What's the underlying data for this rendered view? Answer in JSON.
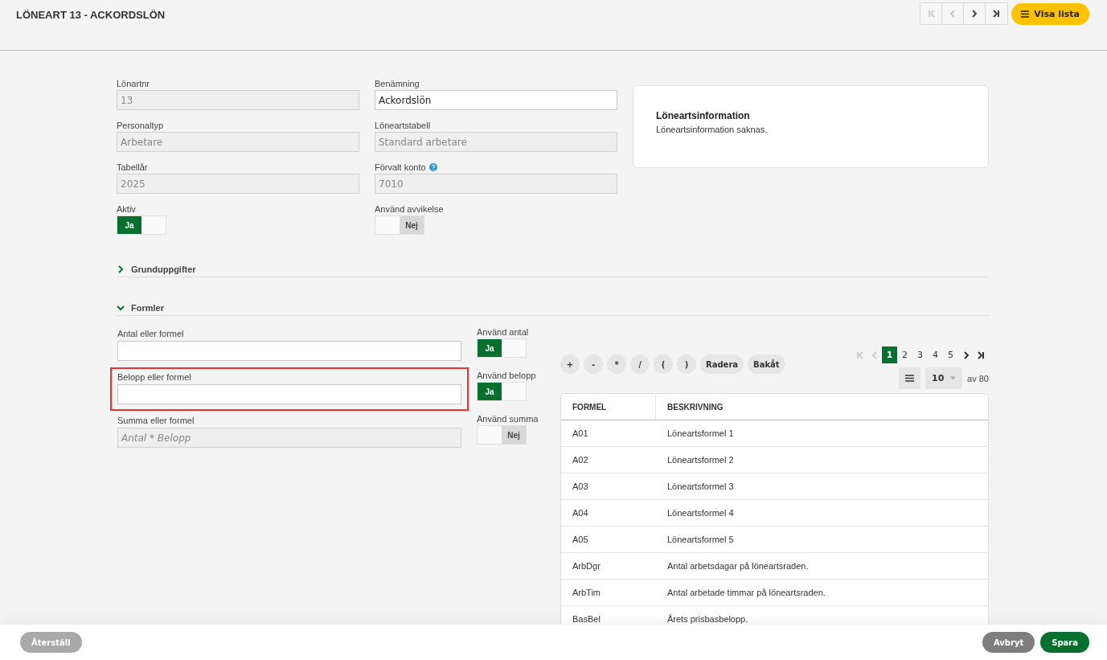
{
  "header": {
    "title": "LÖNEART 13 - ACKORDSLÖN",
    "nav": [
      {
        "kind": "first",
        "disabled": true
      },
      {
        "kind": "prev",
        "disabled": true
      },
      {
        "kind": "next",
        "disabled": false
      },
      {
        "kind": "last",
        "disabled": false
      }
    ],
    "list_button": "Visa lista"
  },
  "fields": [
    {
      "label": "Lönartnr",
      "value": "13",
      "disabled": true,
      "help": false
    },
    {
      "label": "Benämning",
      "value": "Ackordslön",
      "disabled": false,
      "help": false
    },
    {
      "label": "Personaltyp",
      "value": "Arbetare",
      "disabled": true,
      "help": false
    },
    {
      "label": "Löneartstabell",
      "value": "Standard arbetare",
      "disabled": true,
      "help": false
    },
    {
      "label": "Tabellår",
      "value": "2025",
      "disabled": true,
      "help": false
    },
    {
      "label": "Förvalt konto",
      "value": "7010",
      "disabled": true,
      "help": true
    }
  ],
  "toggles": [
    {
      "label": "Aktiv",
      "on": true,
      "text": "Ja"
    },
    {
      "label": "Använd avvikelse",
      "on": false,
      "text": "Nej"
    }
  ],
  "info_card": {
    "title": "Löneartsinformation",
    "text": "Löneartsinformation saknas."
  },
  "sections": [
    {
      "title": "Grunduppgifter",
      "expanded": false
    },
    {
      "title": "Formler",
      "expanded": true
    }
  ],
  "formulas": [
    {
      "label": "Antal eller formel",
      "disabled": false,
      "highlighted": false,
      "toggle": {
        "label": "Använd antal",
        "on": true,
        "text": "Ja"
      }
    },
    {
      "label": "Belopp eller formel",
      "disabled": false,
      "highlighted": true,
      "toggle": {
        "label": "Använd belopp",
        "on": true,
        "text": "Ja"
      }
    },
    {
      "label": "Summa eller formel",
      "placeholder": "Antal * Belopp",
      "disabled": true,
      "highlighted": false,
      "toggle": {
        "label": "Använd summa",
        "on": false,
        "text": "Nej"
      }
    }
  ],
  "operators": [
    "+",
    "-",
    "*",
    "/",
    "(",
    ")",
    "Radera",
    "Bakåt"
  ],
  "pagination": {
    "first_disabled": true,
    "prev_disabled": true,
    "pages": [
      {
        "label": "1",
        "selected": true
      },
      {
        "label": "2",
        "selected": false
      },
      {
        "label": "3",
        "selected": false
      },
      {
        "label": "4",
        "selected": false
      },
      {
        "label": "5",
        "selected": false
      }
    ],
    "per_page": "10",
    "total": "av 80"
  },
  "table": {
    "columns": [
      "FORMEL",
      "BESKRIVNING"
    ],
    "rows": [
      [
        "A01",
        "Löneartsformel 1"
      ],
      [
        "A02",
        "Löneartsformel 2"
      ],
      [
        "A03",
        "Löneartsformel 3"
      ],
      [
        "A04",
        "Löneartsformel 4"
      ],
      [
        "A05",
        "Löneartsformel 5"
      ],
      [
        "ArbDgr",
        "Antal arbetsdagar på löneartsraden."
      ],
      [
        "ArbTim",
        "Antal arbetade timmar på löneartsraden."
      ],
      [
        "BasBel",
        "Årets prisbasbelopp."
      ]
    ]
  },
  "footer": {
    "left_buttons": [
      {
        "label": "Återställ",
        "disabled": true
      }
    ],
    "right_buttons": [
      {
        "label": "Avbryt",
        "kind": "secondary",
        "disabled": false
      },
      {
        "label": "Spara",
        "kind": "primary",
        "disabled": false
      }
    ]
  }
}
